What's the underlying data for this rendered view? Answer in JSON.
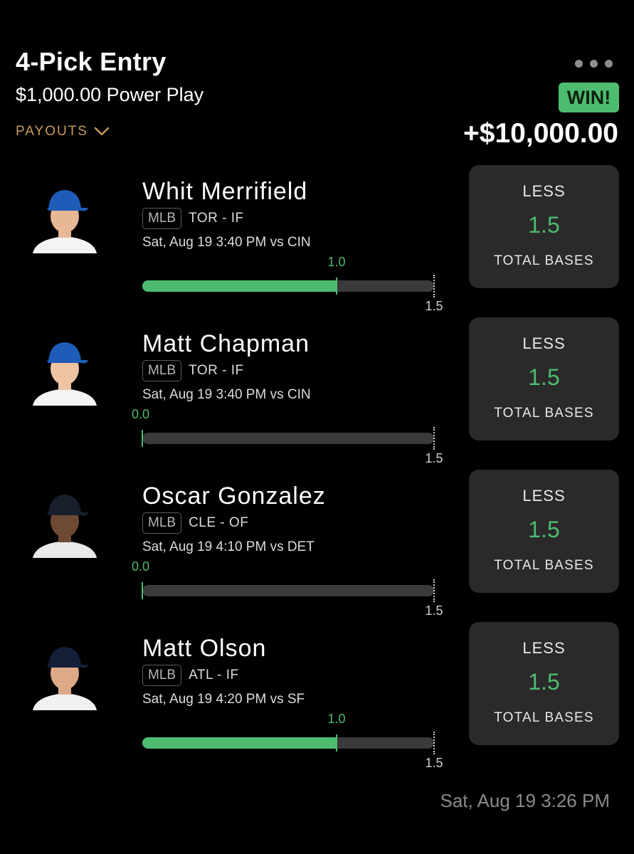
{
  "header": {
    "title": "4-Pick Entry",
    "entry_type": "$1,000.00 Power Play",
    "payouts_label": "PAYOUTS",
    "result_badge": "WIN!",
    "payout_amount": "+$10,000.00",
    "more_icon": "ellipsis-icon",
    "colors": {
      "accent_green": "#4ebc70",
      "payouts_gold": "#c99a5e",
      "card_bg": "#2a2a2a"
    }
  },
  "picks": [
    {
      "name": "Whit Merrifield",
      "league": "MLB",
      "team_position": "TOR - IF",
      "game_time": "Sat, Aug 19 3:40 PM  vs CIN",
      "actual": "1.0",
      "actual_value": 1.0,
      "line": "1.5",
      "line_value": 1.5,
      "direction": "LESS",
      "stat": "TOTAL BASES",
      "cap": "blue-jays"
    },
    {
      "name": "Matt Chapman",
      "league": "MLB",
      "team_position": "TOR - IF",
      "game_time": "Sat, Aug 19 3:40 PM  vs CIN",
      "actual": "0.0",
      "actual_value": 0.0,
      "line": "1.5",
      "line_value": 1.5,
      "direction": "LESS",
      "stat": "TOTAL BASES",
      "cap": "blue-jays"
    },
    {
      "name": "Oscar Gonzalez",
      "league": "MLB",
      "team_position": "CLE - OF",
      "game_time": "Sat, Aug 19 4:10 PM  vs DET",
      "actual": "0.0",
      "actual_value": 0.0,
      "line": "1.5",
      "line_value": 1.5,
      "direction": "LESS",
      "stat": "TOTAL BASES",
      "cap": "guardians"
    },
    {
      "name": "Matt Olson",
      "league": "MLB",
      "team_position": "ATL - IF",
      "game_time": "Sat, Aug 19 4:20 PM  vs SF",
      "actual": "1.0",
      "actual_value": 1.0,
      "line": "1.5",
      "line_value": 1.5,
      "direction": "LESS",
      "stat": "TOTAL BASES",
      "cap": "braves"
    }
  ],
  "footer": {
    "timestamp": "Sat, Aug 19 3:26 PM"
  }
}
